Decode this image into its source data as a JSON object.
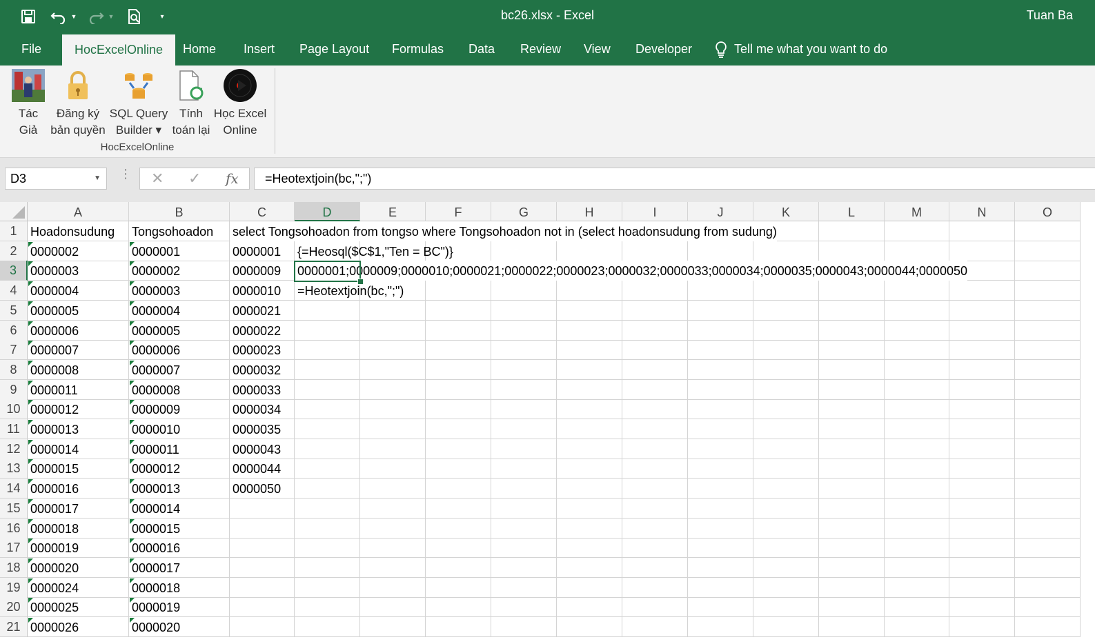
{
  "window": {
    "title": "bc26.xlsx  -  Excel",
    "user": "Tuan Ba"
  },
  "quick_access": {
    "icons": [
      "save-icon",
      "undo-icon",
      "redo-icon",
      "print-preview-icon",
      "customize-icon"
    ]
  },
  "tabs": {
    "file": "File",
    "hocexcelonline": "HocExcelOnline",
    "home": "Home",
    "insert": "Insert",
    "page_layout": "Page Layout",
    "formulas": "Formulas",
    "data": "Data",
    "review": "Review",
    "view": "View",
    "developer": "Developer",
    "active": "HocExcelOnline"
  },
  "tell_me": "Tell me what you want to do",
  "ribbon": {
    "group_label": "HocExcelOnline",
    "buttons": {
      "tac_gia": {
        "line1": "Tác",
        "line2": "Giả"
      },
      "dang_ky": {
        "line1": "Đăng ký",
        "line2": "bản quyền"
      },
      "sql_query": {
        "line1": "SQL Query",
        "line2": "Builder ▾"
      },
      "tinh_toan": {
        "line1": "Tính",
        "line2": "toán lại"
      },
      "hoc_excel": {
        "line1": "Học Excel",
        "line2": "Online"
      }
    }
  },
  "formula_bar": {
    "name_box": "D3",
    "cancel": "✕",
    "enter": "✓",
    "fx": "fx",
    "formula": "=Heotextjoin(bc,\";\")"
  },
  "sheet": {
    "selected_cell": "D3",
    "columns": [
      "A",
      "B",
      "C",
      "D",
      "E",
      "F",
      "G",
      "H",
      "I",
      "J",
      "K",
      "L",
      "M",
      "N",
      "O"
    ],
    "rows": [
      "1",
      "2",
      "3",
      "4",
      "5",
      "6",
      "7",
      "8",
      "9",
      "10",
      "11",
      "12",
      "13",
      "14",
      "15",
      "16",
      "17",
      "18",
      "19",
      "20",
      "21"
    ],
    "colA": [
      "Hoadonsudung",
      "0000002",
      "0000003",
      "0000004",
      "0000005",
      "0000006",
      "0000007",
      "0000008",
      "0000011",
      "0000012",
      "0000013",
      "0000014",
      "0000015",
      "0000016",
      "0000017",
      "0000018",
      "0000019",
      "0000020",
      "0000024",
      "0000025",
      "0000026"
    ],
    "colB": [
      "Tongsohoadon",
      "0000001",
      "0000002",
      "0000003",
      "0000004",
      "0000005",
      "0000006",
      "0000007",
      "0000008",
      "0000009",
      "0000010",
      "0000011",
      "0000012",
      "0000013",
      "0000014",
      "0000015",
      "0000016",
      "0000017",
      "0000018",
      "0000019",
      "0000020"
    ],
    "colC": [
      "select Tongsohoadon from tongso where Tongsohoadon not in (select hoadonsudung from sudung)",
      "0000001",
      "0000009",
      "0000010",
      "0000021",
      "0000022",
      "0000023",
      "0000032",
      "0000033",
      "0000034",
      "0000035",
      "0000043",
      "0000044",
      "0000050"
    ],
    "D2": "{=Heosql($C$1,\"Ten = BC\")}",
    "D3": "0000001;0000009;0000010;0000021;0000022;0000023;0000032;0000033;0000034;0000035;0000043;0000044;0000050",
    "D4": "=Heotextjoin(bc,\";\")"
  },
  "colors": {
    "excel_green": "#217346",
    "ribbon_bg": "#f3f3f3",
    "gridline": "#d4d4d4"
  }
}
